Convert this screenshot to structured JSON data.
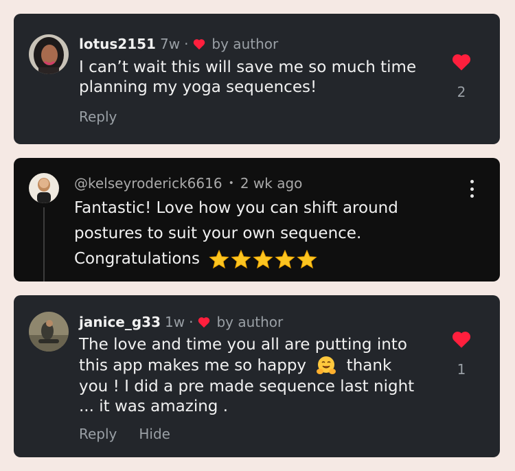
{
  "colors": {
    "page_background": "#f5e9e4",
    "card_background": "#23262b",
    "card_dark_background": "#0f0f0f",
    "heart_red": "#ff1f3d",
    "muted_text": "#9aa0a6",
    "primary_text": "#f1f1f1"
  },
  "comments": [
    {
      "username": "lotus2151",
      "time": "7w",
      "separator": "·",
      "by_author": "by author",
      "text": "I can’t wait this will save me so much time planning my yoga sequences!",
      "likes": "2",
      "actions": [
        "Reply"
      ]
    },
    {
      "username": "@kelseyroderick6616",
      "separator": "•",
      "time": "2 wk ago",
      "text": "Fantastic! Love how you can shift around postures to suit your own sequence. Congratulations",
      "emoji": "star",
      "emoji_count": 5
    },
    {
      "username": "janice_g33",
      "time": "1w",
      "separator": "·",
      "by_author": "by author",
      "text_part1": "The love and time you all are putting into this app makes me so happy",
      "emoji": "hugging-face",
      "text_part2": "thank you ! I did a pre made sequence last night ... it was amazing .",
      "likes": "1",
      "actions": [
        "Reply",
        "Hide"
      ]
    }
  ]
}
